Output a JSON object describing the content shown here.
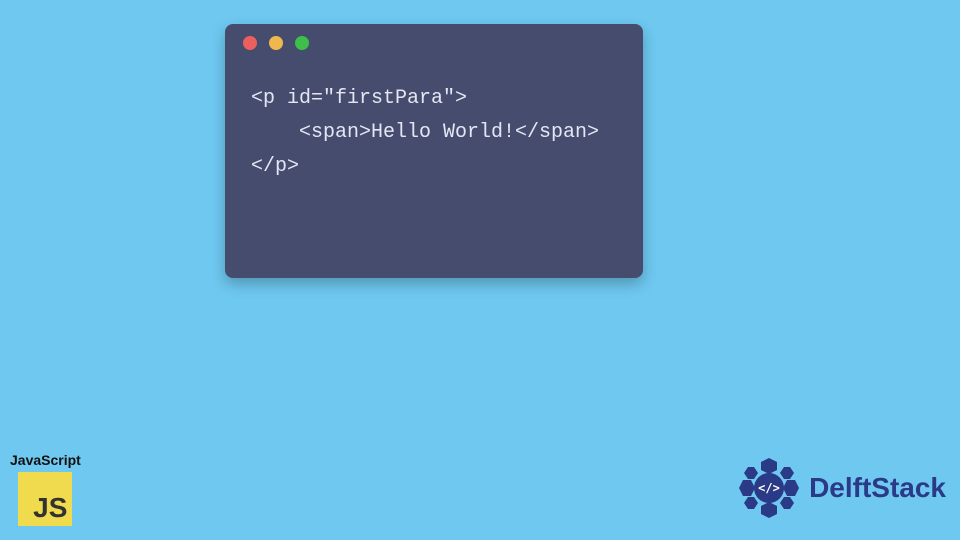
{
  "code": {
    "line1": "<p id=\"firstPara\">",
    "line2": "    <span>Hello World!</span>",
    "line3": "</p>"
  },
  "window": {
    "close_name": "close-icon",
    "min_name": "minimize-icon",
    "max_name": "maximize-icon"
  },
  "jsBadge": {
    "label": "JavaScript",
    "logoText": "JS"
  },
  "brand": {
    "name": "DelftStack",
    "logoGlyph": "</>"
  },
  "colors": {
    "background": "#6ec8f0",
    "windowBg": "#454c6d",
    "codeText": "#e4e7f3",
    "jsYellow": "#f0db4f",
    "brandBlue": "#2a3a87",
    "dotRed": "#ec5f5f",
    "dotYellow": "#f0b84c",
    "dotGreen": "#3ebe4a"
  }
}
